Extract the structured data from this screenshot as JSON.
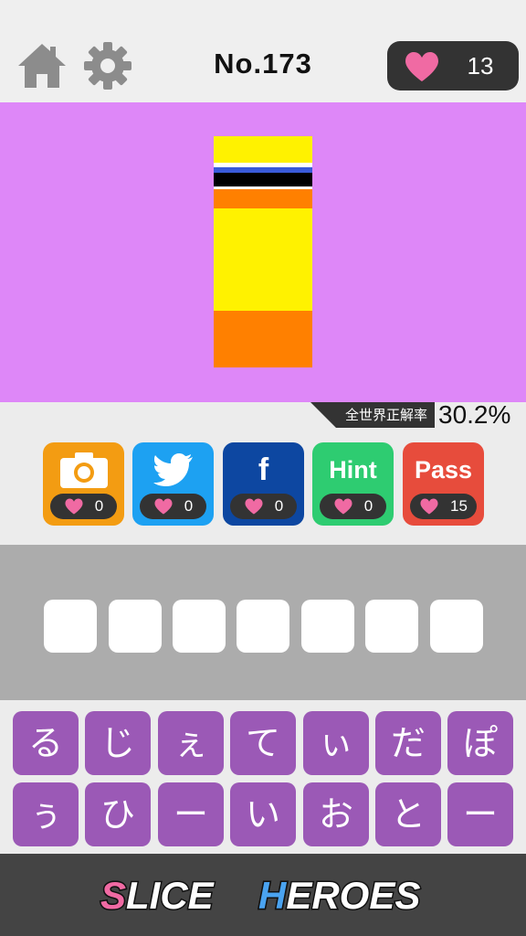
{
  "header": {
    "level_title": "No.173",
    "hearts_count": "13",
    "icons": {
      "home": "home-icon",
      "settings": "gear-icon",
      "hearts": "heart-icon"
    }
  },
  "puzzle": {
    "background": "#de87f8",
    "slice_colors": [
      "#fff200",
      "#ffffff",
      "#3a5bd9",
      "#000000",
      "#ffffff",
      "#ff8000",
      "#fff200",
      "#ff8000"
    ]
  },
  "accuracy": {
    "label": "全世界正解率",
    "value": "30.2%"
  },
  "actions": [
    {
      "id": "camera",
      "icon": "camera-icon",
      "text": "",
      "cost": "0",
      "color": "#f39c12"
    },
    {
      "id": "twitter",
      "icon": "twitter-icon",
      "text": "",
      "cost": "0",
      "color": "#1da1f2"
    },
    {
      "id": "facebook",
      "icon": "facebook-icon",
      "text": "f",
      "cost": "0",
      "color": "#0d47a1"
    },
    {
      "id": "hint",
      "icon": "hint",
      "text": "Hint",
      "cost": "0",
      "color": "#2ecc71"
    },
    {
      "id": "pass",
      "icon": "pass",
      "text": "Pass",
      "cost": "15",
      "color": "#e74c3c"
    }
  ],
  "answer": {
    "slot_count": 7
  },
  "keyboard": {
    "row1": [
      "る",
      "じ",
      "ぇ",
      "て",
      "ぃ",
      "だ",
      "ぽ"
    ],
    "row2": [
      "ぅ",
      "ひ",
      "ー",
      "い",
      "お",
      "と",
      "ー"
    ]
  },
  "footer": {
    "logo_text_1": "SLICE",
    "logo_text_2": "HEROES"
  }
}
